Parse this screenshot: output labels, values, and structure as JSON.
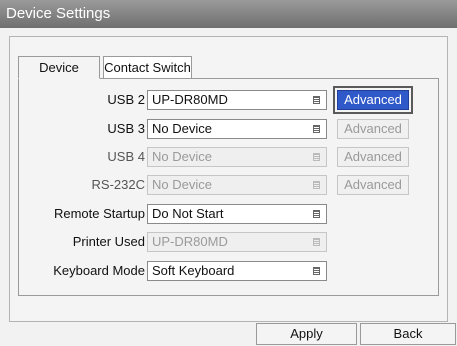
{
  "window": {
    "title": "Device Settings"
  },
  "tabs": [
    {
      "label": "Device",
      "active": true
    },
    {
      "label": "Contact Switch",
      "active": false
    }
  ],
  "rows": [
    {
      "label": "USB 2",
      "value": "UP-DR80MD",
      "enabled": true,
      "button": "Advanced",
      "button_enabled": true
    },
    {
      "label": "USB 3",
      "value": "No Device",
      "enabled": true,
      "button": "Advanced",
      "button_enabled": false
    },
    {
      "label": "USB 4",
      "value": "No Device",
      "enabled": false,
      "button": "Advanced",
      "button_enabled": false
    },
    {
      "label": "RS-232C",
      "value": "No Device",
      "enabled": false,
      "button": "Advanced",
      "button_enabled": false
    },
    {
      "label": "Remote Startup",
      "value": "Do Not Start",
      "enabled": true
    },
    {
      "label": "Printer Used",
      "value": "UP-DR80MD",
      "enabled": false
    },
    {
      "label": "Keyboard Mode",
      "value": "Soft Keyboard",
      "enabled": true
    }
  ],
  "footer": {
    "apply_label": "Apply",
    "back_label": "Back"
  },
  "colors": {
    "accent": "#2f58c8",
    "titlebar": "#7f7f7f"
  }
}
